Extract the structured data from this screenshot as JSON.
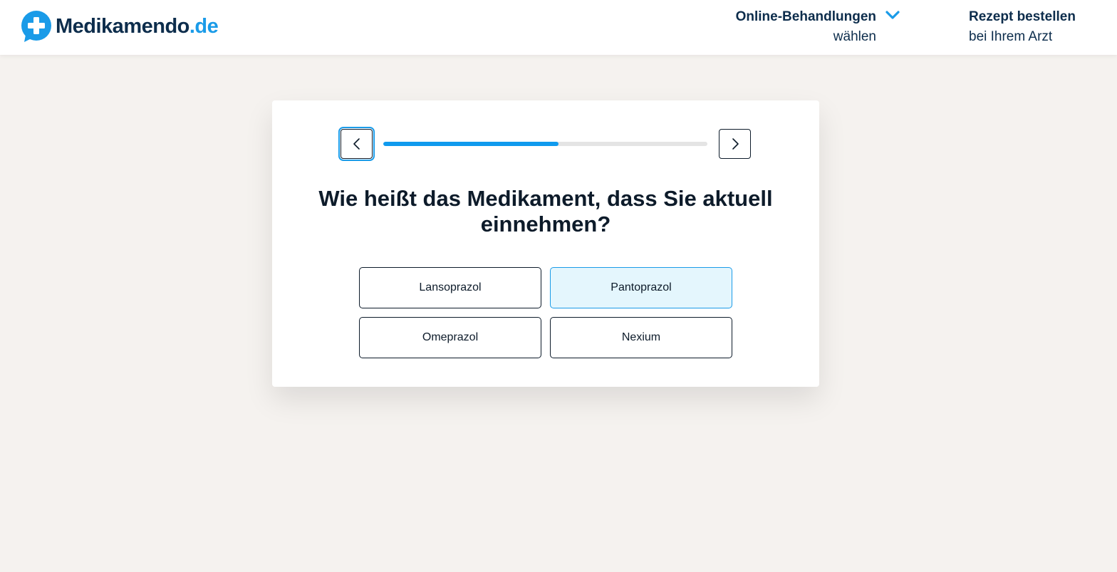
{
  "header": {
    "logo": {
      "main": "Medikamendo",
      "tld": ".de",
      "icon": "chat-bubble-plus-icon"
    },
    "nav": [
      {
        "title": "Online-Behandlungen",
        "subtitle": "wählen",
        "icon": "chevron-down-icon"
      },
      {
        "title": "Rezept bestellen",
        "subtitle": "bei Ihrem Arzt"
      }
    ]
  },
  "questionnaire": {
    "progress_percent": 54,
    "back_icon": "chevron-left-icon",
    "next_icon": "chevron-right-icon",
    "question": "Wie heißt das Medikament, dass Sie aktuell einnehmen?",
    "options": [
      {
        "label": "Lansoprazol",
        "selected": false
      },
      {
        "label": "Pantoprazol",
        "selected": true
      },
      {
        "label": "Omeprazol",
        "selected": false
      },
      {
        "label": "Nexium",
        "selected": false
      }
    ]
  },
  "colors": {
    "accent": "#0f9aee",
    "brand_dark": "#0d2d4c",
    "background": "#f5f2ef",
    "selected_bg": "#e4f6fd"
  }
}
